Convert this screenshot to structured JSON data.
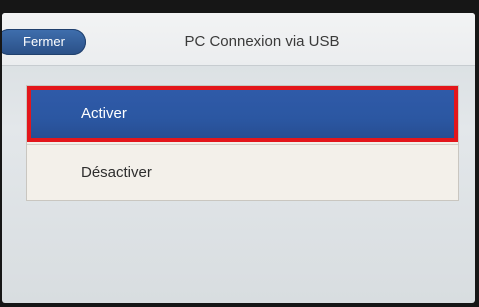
{
  "header": {
    "close_label": "Fermer",
    "title": "PC Connexion via USB"
  },
  "menu": {
    "items": [
      {
        "label": "Activer",
        "selected": true
      },
      {
        "label": "Désactiver",
        "selected": false
      }
    ]
  },
  "colors": {
    "selected_item": "#2b57a2",
    "selection_highlight": "#e3161b",
    "close_button": "#2f5c9a"
  }
}
